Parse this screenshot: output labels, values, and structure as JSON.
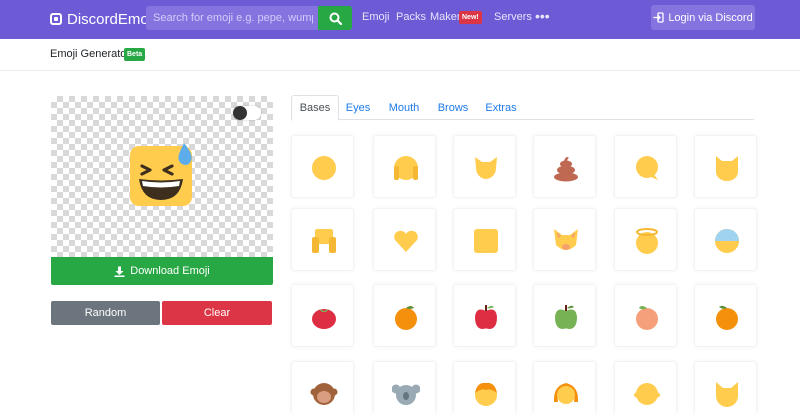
{
  "navbar": {
    "brand": "DiscordEmoji",
    "search_placeholder": "Search for emoji e.g. pepe, wumpus...",
    "links": {
      "emoji": "Emoji",
      "packs": "Packs",
      "maker": "Maker",
      "servers": "Servers",
      "more": "•••"
    },
    "new_badge": "New!",
    "login": "Login via Discord"
  },
  "subheader": {
    "title": "Emoji Generator",
    "badge": "Beta"
  },
  "generator": {
    "download_label": "Download Emoji",
    "random_label": "Random",
    "clear_label": "Clear"
  },
  "tabs": [
    {
      "label": "Bases",
      "active": true
    },
    {
      "label": "Eyes"
    },
    {
      "label": "Mouth"
    },
    {
      "label": "Brows"
    },
    {
      "label": "Extras"
    }
  ],
  "parts": [
    [
      "circle-base-icon",
      "round-ears-base-icon",
      "horned-base-icon",
      "poop-base-icon",
      "speech-bubble-base-icon",
      "cat-base-icon"
    ],
    [
      "hands-base-icon",
      "heart-base-icon",
      "square-base-icon",
      "fox-base-icon",
      "halo-base-icon",
      "cold-base-icon"
    ],
    [
      "tomato-base-icon",
      "orange-base-icon",
      "apple-base-icon",
      "green-apple-base-icon",
      "peach-base-icon",
      "tangerine-base-icon"
    ],
    [
      "monkey-base-icon",
      "koala-base-icon",
      "hair-base-icon",
      "pigtails-base-icon",
      "bald-base-icon",
      "cat-ears-base-icon"
    ]
  ],
  "colors": {
    "navbar": "#6d5bd6",
    "accent_green": "#28a745",
    "danger_red": "#dc3545",
    "secondary_gray": "#6c757d",
    "link_blue": "#1e7be6",
    "emoji_yellow": "#ffcc4d"
  }
}
